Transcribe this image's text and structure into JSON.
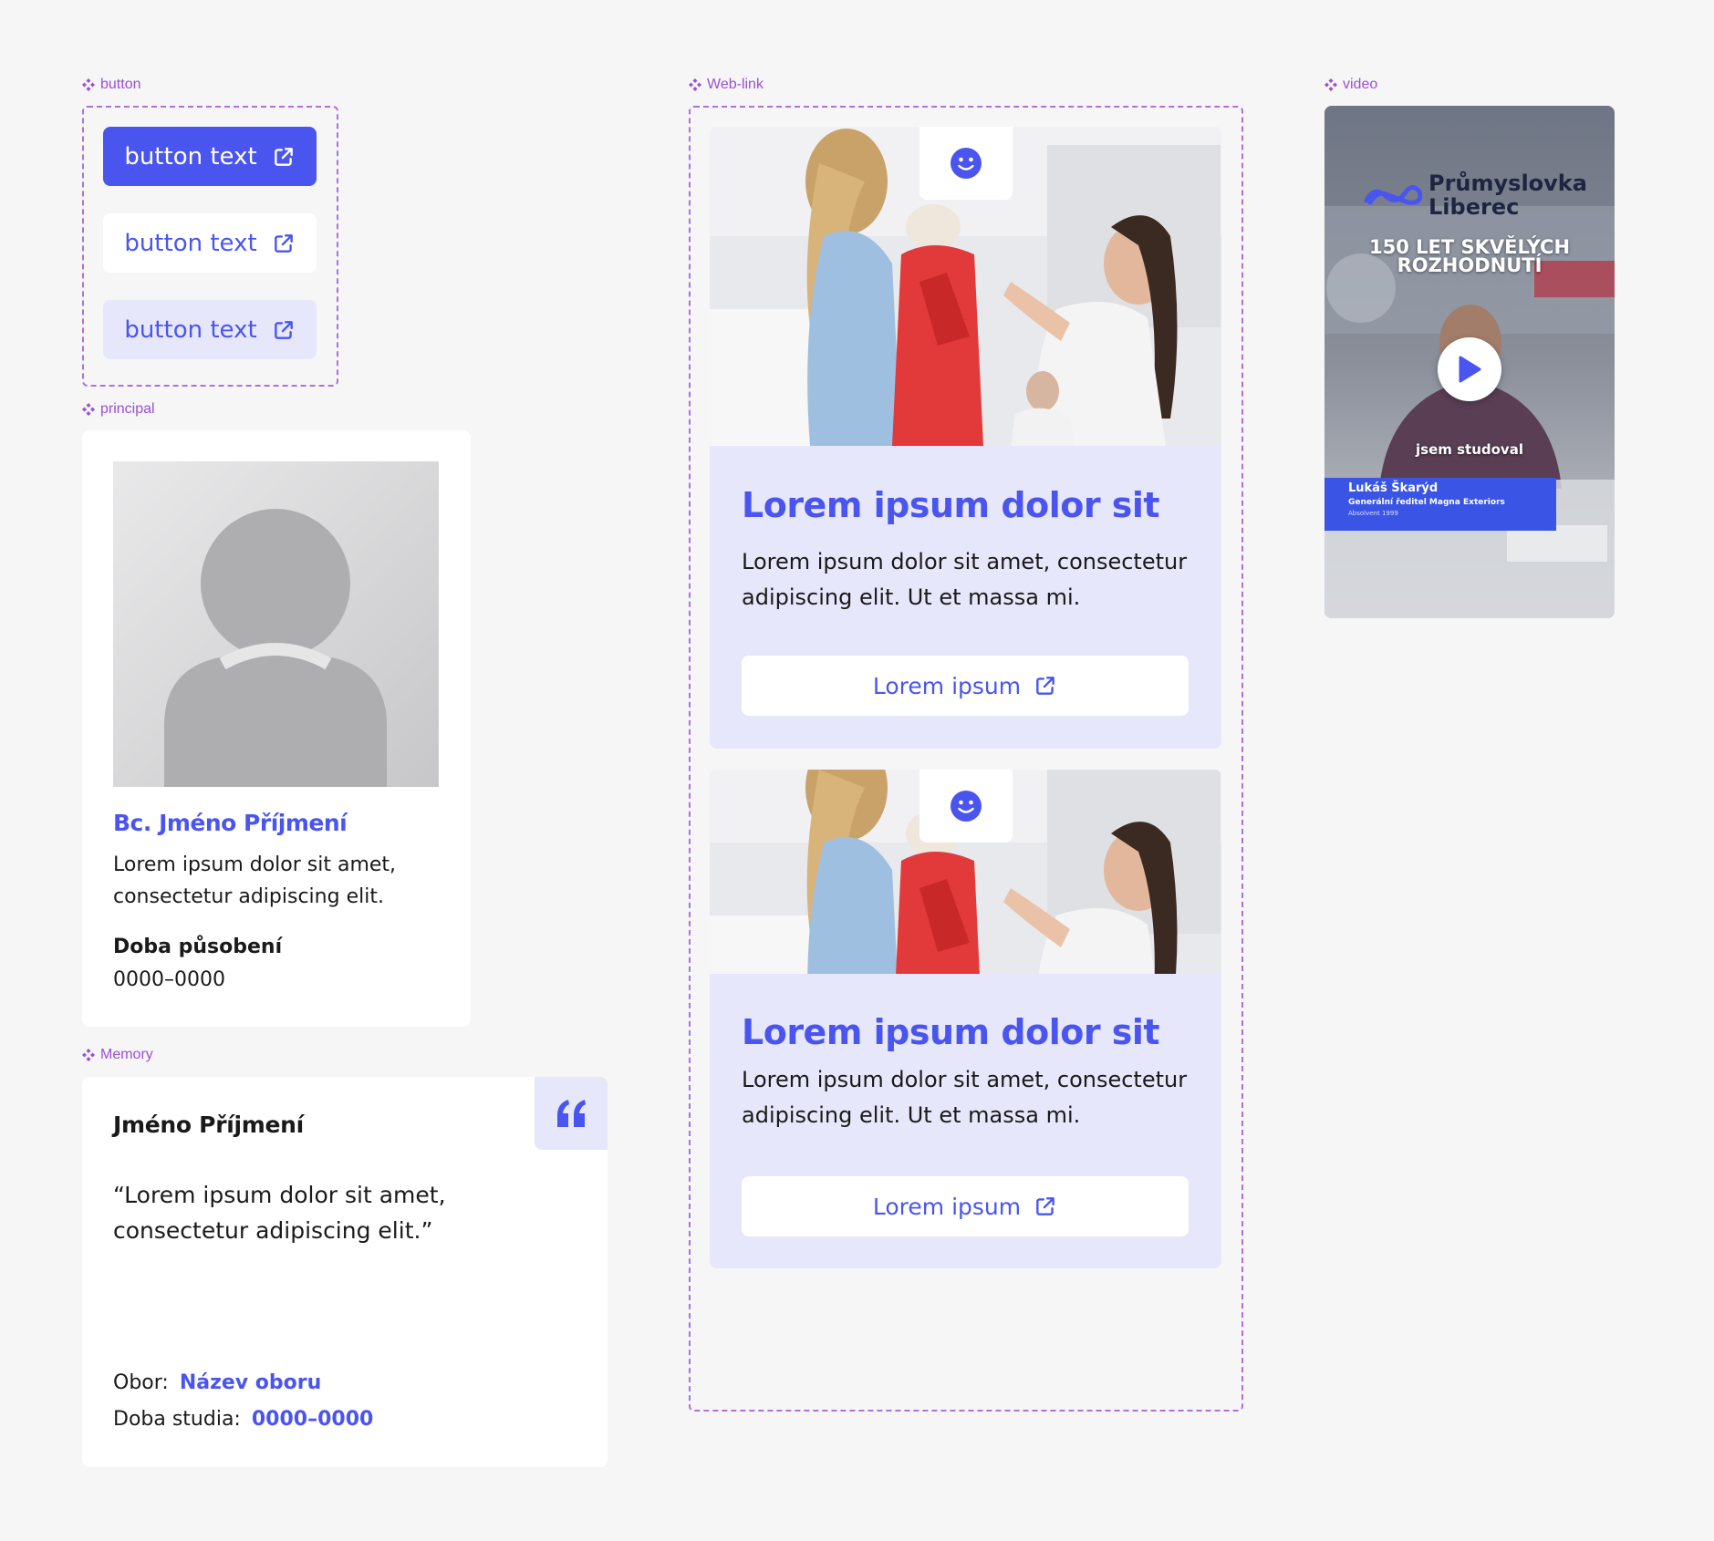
{
  "labels": {
    "button": "button",
    "weblink": "Web-link",
    "video": "video",
    "principal": "principal",
    "memory": "Memory"
  },
  "buttons": {
    "primary": "button text",
    "secondary": "button text",
    "tertiary": "button text"
  },
  "principal": {
    "name": "Bc. Jméno Příjmení",
    "desc": "Lorem ipsum dolor sit amet, consectetur adipiscing elit.",
    "tenure_label": "Doba působení",
    "tenure_value": "0000–0000"
  },
  "memory": {
    "name": "Jméno Příjmení",
    "quote": "“Lorem ipsum dolor sit amet, consectetur adipiscing elit.”",
    "field_label": "Obor:",
    "field_value": "Název oboru",
    "study_label": "Doba studia:",
    "study_value": "0000–0000"
  },
  "weblinks": [
    {
      "title": "Lorem ipsum dolor sit",
      "text": "Lorem ipsum dolor sit amet, consectetur adipiscing elit. Ut et massa mi.",
      "button": "Lorem ipsum"
    },
    {
      "title": "Lorem ipsum dolor sit",
      "text": "Lorem ipsum dolor sit amet, consectetur adipiscing elit. Ut et massa mi.",
      "button": "Lorem ipsum"
    }
  ],
  "video": {
    "brand_line1": "Průmyslovka",
    "brand_line2": "Liberec",
    "headline1": "150 LET SKVĚLÝCH",
    "headline2": "ROZHODNUTÍ",
    "subtitle": "jsem studoval",
    "person_name": "Lukáš Škarýd",
    "person_role": "Generální ředitel Magna Exteriors",
    "person_note": "Absolvent 1999"
  },
  "colors": {
    "accent": "#4a55f0",
    "accent_light": "#e7e7fb",
    "label_purple": "#9b4fd6",
    "background": "#f6f6f6"
  },
  "icons": {
    "component": "component-diamond-icon",
    "external": "external-link-icon",
    "smile": "smile-icon",
    "quote": "quote-icon",
    "play": "play-icon"
  }
}
